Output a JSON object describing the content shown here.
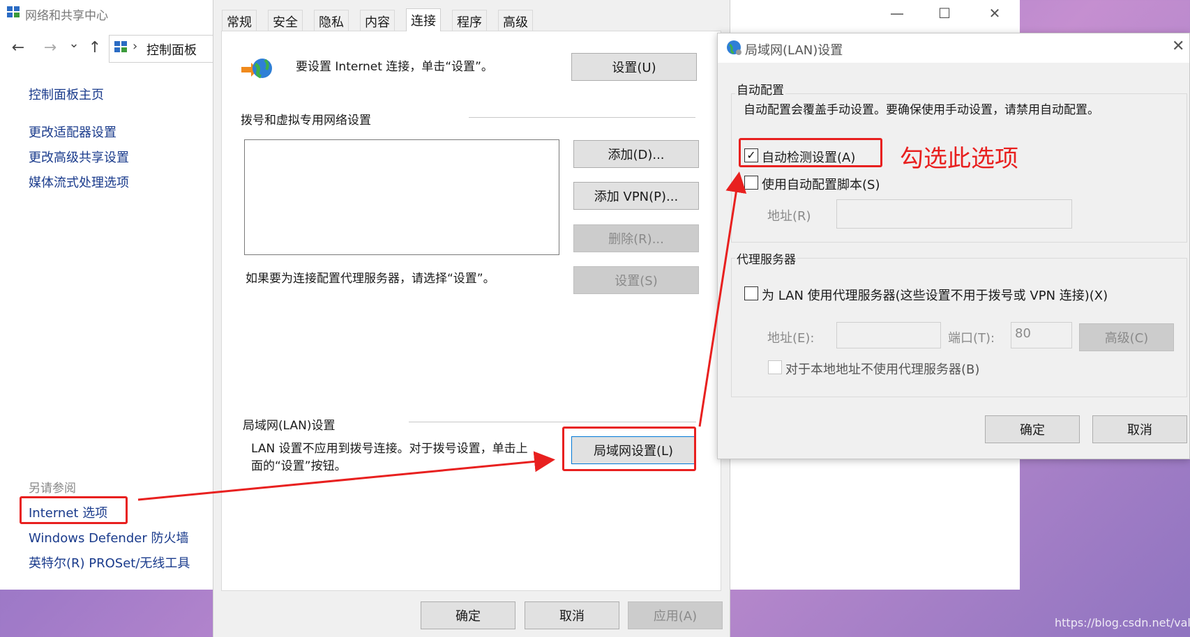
{
  "control_panel": {
    "title": "网络和共享中心",
    "address": "控制面板",
    "address_chevron": "›",
    "window_controls": {
      "minimize": "—",
      "maximize": "☐",
      "close": "✕"
    },
    "nav": {
      "back": "←",
      "forward": "→",
      "dropdown": "⌄",
      "up": "↑"
    },
    "links": {
      "home": "控制面板主页",
      "adapter": "更改适配器设置",
      "sharing": "更改高级共享设置",
      "media": "媒体流式处理选项"
    },
    "see_also_label": "另请参阅",
    "see_also": {
      "internet_options": "Internet 选项",
      "firewall": "Windows Defender 防火墙",
      "proset": "英特尔(R) PROSet/无线工具"
    }
  },
  "internet_properties": {
    "tabs": [
      "常规",
      "安全",
      "隐私",
      "内容",
      "连接",
      "程序",
      "高级"
    ],
    "active_tab": "连接",
    "setup_text": "要设置 Internet 连接，单击“设置”。",
    "setup_button": "设置(U)",
    "dialup_group": "拨号和虚拟专用网络设置",
    "add_button": "添加(D)...",
    "add_vpn_button": "添加 VPN(P)...",
    "remove_button": "删除(R)...",
    "settings_button": "设置(S)",
    "proxy_hint": "如果要为连接配置代理服务器，请选择“设置”。",
    "lan_group": "局域网(LAN)设置",
    "lan_text_line1": "LAN 设置不应用到拨号连接。对于拨号设置，单击上",
    "lan_text_line2": "面的“设置”按钮。",
    "lan_button": "局域网设置(L)",
    "ok": "确定",
    "cancel": "取消",
    "apply": "应用(A)"
  },
  "lan_settings": {
    "title": "局域网(LAN)设置",
    "close": "✕",
    "auto_config_group": "自动配置",
    "auto_config_desc": "自动配置会覆盖手动设置。要确保使用手动设置，请禁用自动配置。",
    "auto_detect_label": "自动检测设置(A)",
    "auto_detect_checked": "✓",
    "use_script_label": "使用自动配置脚本(S)",
    "script_address_label": "地址(R)",
    "proxy_group": "代理服务器",
    "use_proxy_label": "为 LAN 使用代理服务器(这些设置不用于拨号或 VPN 连接)(X)",
    "proxy_address_label": "地址(E):",
    "port_label": "端口(T):",
    "port_value": "80",
    "advanced_button": "高级(C)",
    "bypass_label": "对于本地地址不使用代理服务器(B)",
    "ok": "确定",
    "cancel": "取消"
  },
  "annotation": {
    "text": "勾选此选项",
    "color": "#e8201f"
  },
  "watermark": "https://blog.csdn.net/vale_"
}
